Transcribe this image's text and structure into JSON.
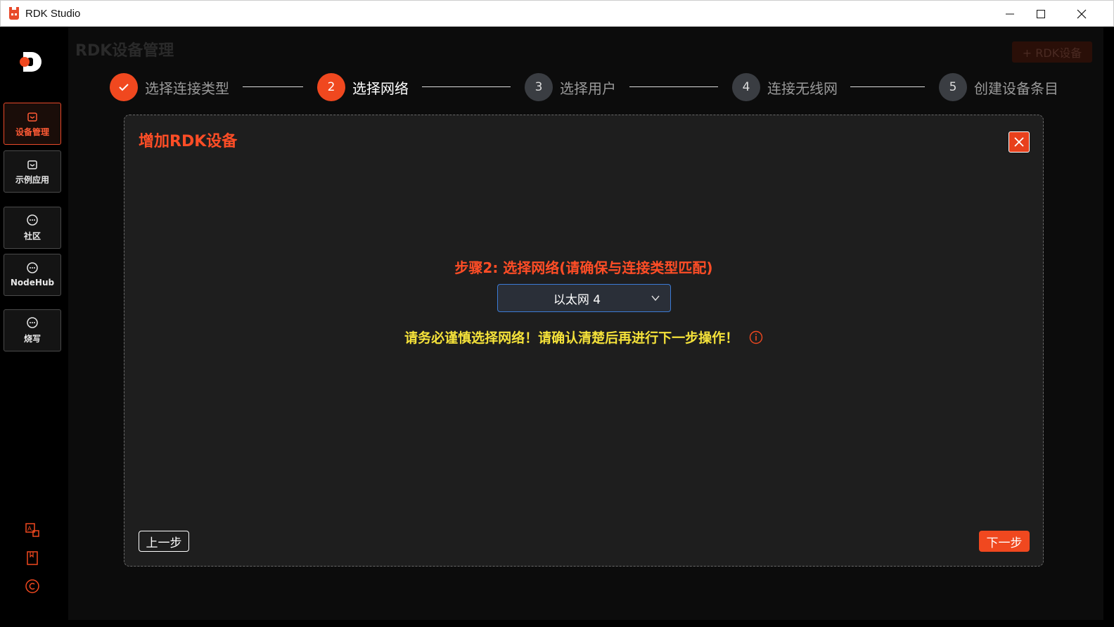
{
  "window": {
    "title": "RDK Studio"
  },
  "sidebar": {
    "items": [
      {
        "label": "设备管理",
        "icon": "box-icon",
        "active": true
      },
      {
        "label": "示例应用",
        "icon": "box-icon",
        "active": false
      },
      {
        "label": "社区",
        "icon": "chat-icon",
        "active": false
      },
      {
        "label": "NodeHub",
        "icon": "chat-icon",
        "active": false
      },
      {
        "label": "烧写",
        "icon": "chat-icon",
        "active": false
      }
    ],
    "bottom_icons": [
      "translate-icon",
      "book-icon",
      "copyright-icon"
    ]
  },
  "header": {
    "title": "RDK设备管理",
    "add_button": "+ RDK设备"
  },
  "steps": [
    {
      "number": "✓",
      "label": "选择连接类型",
      "state": "done"
    },
    {
      "number": "2",
      "label": "选择网络",
      "state": "active"
    },
    {
      "number": "3",
      "label": "选择用户",
      "state": "pending"
    },
    {
      "number": "4",
      "label": "连接无线网",
      "state": "pending"
    },
    {
      "number": "5",
      "label": "创建设备条目",
      "state": "pending"
    }
  ],
  "dialog": {
    "title": "增加RDK设备",
    "step_heading": "步骤2: 选择网络(请确保与连接类型匹配)",
    "network_select": {
      "value": "以太网 4"
    },
    "warning": "请务必谨慎选择网络！请确认清楚后再进行下一步操作！",
    "prev_button": "上一步",
    "next_button": "下一步"
  },
  "colors": {
    "accent": "#f0481f",
    "warning": "#f5e23a",
    "select_border": "#3b7bd6"
  }
}
